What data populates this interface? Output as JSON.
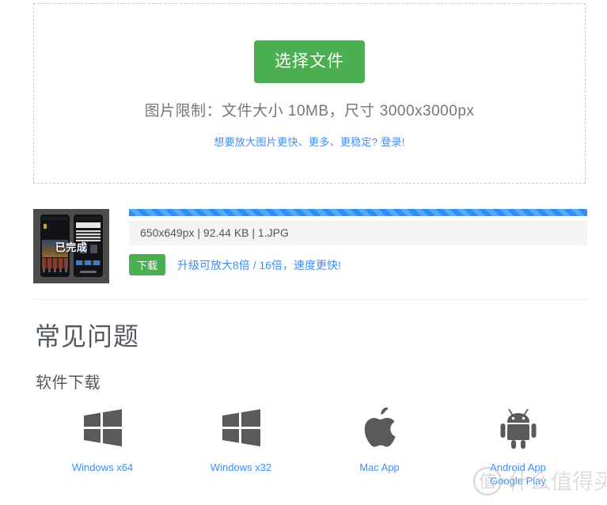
{
  "uploader": {
    "select_button_label": "选择文件",
    "limit_text": "图片限制：文件大小 10MB，尺寸 3000x3000px",
    "login_link": "想要放大图片更快、更多、更稳定? 登录!",
    "accent_green": "#4aaf50",
    "link_blue": "#3d8ef7",
    "border_color": "#cccccc"
  },
  "file": {
    "thumbnail_status": "已完成",
    "info": "650x649px | 92.44 KB | 1.JPG",
    "dimensions": "650x649px",
    "size": "92.44 KB",
    "name": "1.JPG",
    "download_label": "下载",
    "upgrade_link": "升级可放大8倍 / 16倍，速度更快!",
    "progress_percent": 100,
    "progress_color": "#2b8ef4"
  },
  "faq": {
    "title": "常见问题",
    "subtitle": "软件下载"
  },
  "downloads": [
    {
      "icon": "windows-icon",
      "label": "Windows x64",
      "label2": ""
    },
    {
      "icon": "windows-icon",
      "label": "Windows x32",
      "label2": ""
    },
    {
      "icon": "apple-icon",
      "label": "Mac App",
      "label2": ""
    },
    {
      "icon": "android-icon",
      "label": "Android App",
      "label2": "Google Play"
    }
  ],
  "watermark": {
    "badge": "值",
    "text": "什么值得买"
  }
}
